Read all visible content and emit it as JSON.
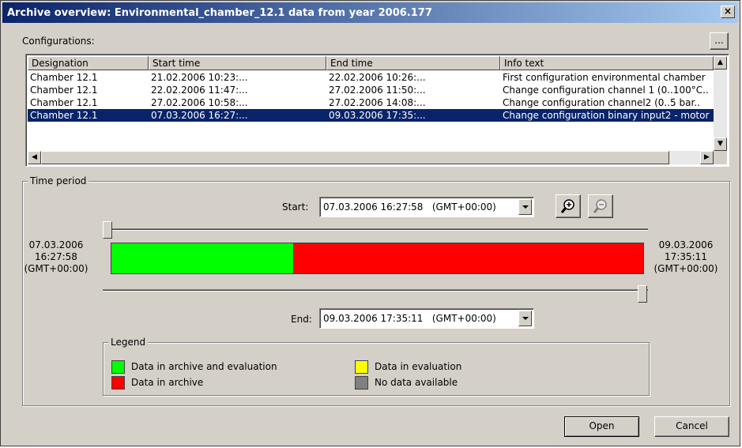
{
  "window": {
    "title": "Archive overview: Environmental_chamber_12.1 data from year 2006.177",
    "close_glyph": "×"
  },
  "configurations": {
    "label": "Configurations:",
    "more_button": "...",
    "columns": [
      "Designation",
      "Start time",
      "End time",
      "Info text"
    ],
    "rows": [
      {
        "designation": "Chamber 12.1",
        "start": "21.02.2006 10:23:...",
        "end": "22.02.2006 10:26:...",
        "info": "First configuration environmental chamber",
        "selected": false
      },
      {
        "designation": "Chamber 12.1",
        "start": "22.02.2006 11:47:...",
        "end": "27.02.2006 11:50:...",
        "info": "Change configuration channel 1 (0..100°C..",
        "selected": false
      },
      {
        "designation": "Chamber 12.1",
        "start": "27.02.2006 10:58:...",
        "end": "27.02.2006 14:08:...",
        "info": "Change configuration channel2 (0..5 bar..",
        "selected": false
      },
      {
        "designation": "Chamber 12.1",
        "start": "07.03.2006 16:27:...",
        "end": "09.03.2006 17:35:...",
        "info": "Change configuration binary input2 - motor",
        "selected": true
      }
    ]
  },
  "time_period": {
    "label": "Time period",
    "start_label": "Start:",
    "start_value": "07.03.2006 16:27:58   (GMT+00:00)",
    "end_label": "End:",
    "end_value": "09.03.2006 17:35:11   (GMT+00:00)",
    "left_time": {
      "date": "07.03.2006",
      "time": "16:27:58",
      "tz": "(GMT+00:00)"
    },
    "right_time": {
      "date": "09.03.2006",
      "time": "17:35:11",
      "tz": "(GMT+00:00)"
    },
    "zoom_in_icon": "zoom-in-icon",
    "zoom_out_icon": "zoom-out-icon",
    "coverage": [
      {
        "type": "archive_and_evaluation",
        "fraction": 0.342,
        "color": "#00ff00"
      },
      {
        "type": "archive",
        "fraction": 0.658,
        "color": "#ff0000"
      }
    ],
    "start_slider_position": 0.0,
    "end_slider_position": 1.0
  },
  "legend": {
    "label": "Legend",
    "items": [
      {
        "label": "Data in archive and evaluation",
        "color": "#00ff00"
      },
      {
        "label": "Data in archive",
        "color": "#ff0000"
      },
      {
        "label": "Data in evaluation",
        "color": "#ffff00"
      },
      {
        "label": "No data available",
        "color": "#808080"
      }
    ]
  },
  "buttons": {
    "open": "Open",
    "cancel": "Cancel"
  }
}
